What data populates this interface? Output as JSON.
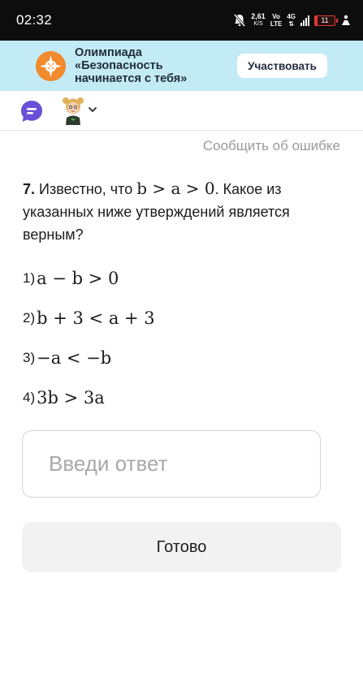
{
  "status_bar": {
    "time": "02:32",
    "speed_value": "2,61",
    "speed_unit": "K/S",
    "net_top": "Vo",
    "net_bottom": "LTE",
    "network_type": "4G",
    "battery_level": "11",
    "battery_color": "#e03a3a"
  },
  "banner": {
    "title": "Олимпиада «Безопасность начинается с тебя»",
    "button_label": "Участвовать",
    "background_color": "#c3ebf6",
    "logo_color": "#f28a2e"
  },
  "header": {
    "chat_icon_color": "#6a4fd8",
    "avatar_icon": "girl-avatar-icon",
    "chevron_icon": "chevron-down-icon"
  },
  "report_link": "Сообщить об ошибке",
  "question": {
    "number": "7.",
    "text_before": " Известно, что ",
    "condition": "b > a > 0",
    "text_after": ". Какое из указанных ниже утверждений является верным?"
  },
  "options": [
    {
      "num": "1)",
      "expr": "a − b > 0"
    },
    {
      "num": "2)",
      "expr": "b + 3 < a + 3"
    },
    {
      "num": "3)",
      "expr": "−a < −b"
    },
    {
      "num": "4)",
      "expr": "3b > 3a"
    }
  ],
  "answer": {
    "placeholder": "Введи ответ",
    "value": ""
  },
  "done_button": "Готово"
}
